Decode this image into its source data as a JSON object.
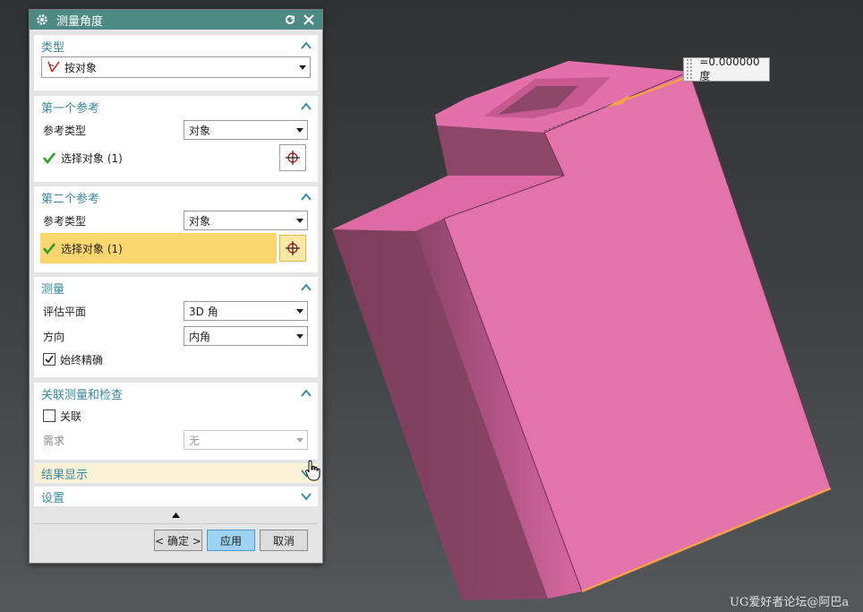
{
  "dialog": {
    "title": "测量角度",
    "groups": {
      "type": {
        "header": "类型",
        "value": "按对象"
      },
      "ref1": {
        "header": "第一个参考",
        "ref_type_label": "参考类型",
        "ref_type_value": "对象",
        "select_label": "选择对象 (1)"
      },
      "ref2": {
        "header": "第二个参考",
        "ref_type_label": "参考类型",
        "ref_type_value": "对象",
        "select_label": "选择对象 (1)"
      },
      "measure": {
        "header": "测量",
        "eval_plane_label": "评估平面",
        "eval_plane_value": "3D 角",
        "direction_label": "方向",
        "direction_value": "内角",
        "always_accurate_label": "始终精确",
        "always_accurate_checked": true
      },
      "assoc": {
        "header": "关联测量和检查",
        "assoc_label": "关联",
        "assoc_checked": false,
        "requirement_label": "需求",
        "requirement_value": "无"
      },
      "results": {
        "header": "结果显示"
      },
      "settings": {
        "header": "设置"
      }
    },
    "buttons": {
      "ok": "< 确定 >",
      "apply": "应用",
      "cancel": "取消"
    }
  },
  "viewport": {
    "measurement_readout": "=0.000000 度",
    "watermark": "UG爱好者论坛@阿巴a",
    "colors": {
      "part_face": "#e170a9",
      "part_side": "#7e3f5e",
      "edge_highlight": "#f5a14a",
      "accent": "#3a8aa0"
    }
  }
}
